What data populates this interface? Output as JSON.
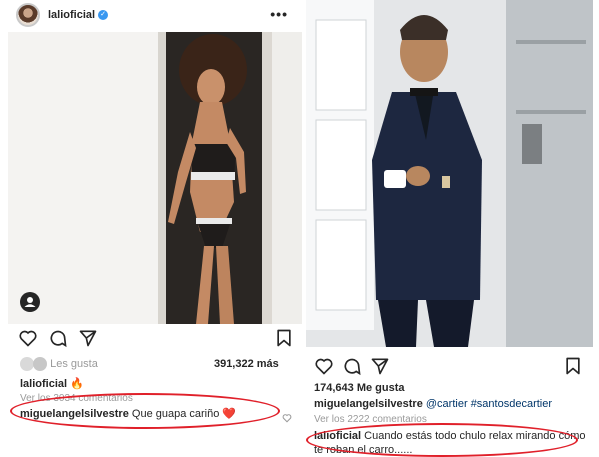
{
  "left_post": {
    "username": "lalioficial",
    "verified_badge": "✓",
    "more": "•••",
    "likes": {
      "prefix": "Les gusta",
      "count": "391,322 más"
    },
    "caption": {
      "user": "lalioficial",
      "emoji": "🔥"
    },
    "view_comments": "Ver los 3034 comentarios",
    "comment": {
      "user": "miguelangelsilvestre",
      "text": "Que guapa cariño",
      "emoji": "❤️"
    },
    "icons": [
      "heart-icon",
      "comment-icon",
      "share-icon",
      "bookmark-icon",
      "user-tag-icon"
    ]
  },
  "right_post": {
    "likes": "174,643 Me gusta",
    "caption": {
      "user": "miguelangelsilvestre",
      "mention": "@cartier",
      "hashtag": "#santosdecartier"
    },
    "view_comments": "Ver los 2222 comentarios",
    "comment": {
      "user": "lalioficial",
      "line1": "Cuando estás todo chulo relax mirando cómo",
      "line2": "te roban el carro......"
    },
    "icons": [
      "heart-icon",
      "comment-icon",
      "share-icon",
      "bookmark-icon"
    ]
  },
  "colors": {
    "highlight": "#e0202a",
    "text": "#262626",
    "muted": "#9a9a9a",
    "link": "#003569"
  }
}
